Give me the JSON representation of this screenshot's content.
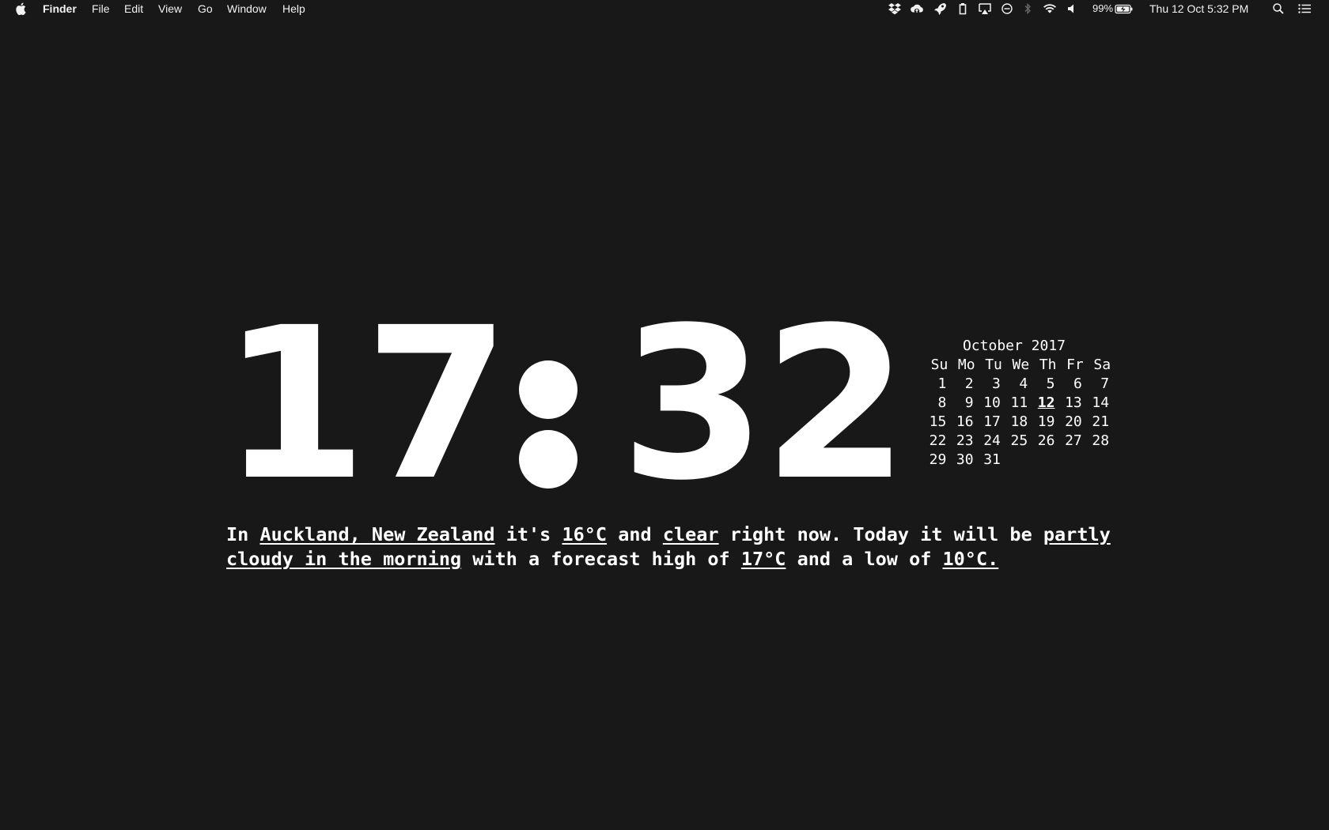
{
  "menubar": {
    "app_name": "Finder",
    "menus": [
      "File",
      "Edit",
      "View",
      "Go",
      "Window",
      "Help"
    ],
    "status_icons": [
      "dropbox-icon",
      "cloud-upload-icon",
      "rocket-icon",
      "clipboard-icon",
      "airplay-icon",
      "do-not-disturb-icon",
      "bluetooth-icon",
      "wifi-icon",
      "volume-icon",
      "battery-icon",
      "spotlight-icon",
      "notification-center-icon"
    ],
    "battery_percent": "99%",
    "datetime": "Thu 12 Oct  5:32 PM"
  },
  "clock": {
    "hours": "17",
    "minutes": "32"
  },
  "calendar": {
    "title": "October 2017",
    "weekdays": [
      "Su",
      "Mo",
      "Tu",
      "We",
      "Th",
      "Fr",
      "Sa"
    ],
    "weeks": [
      [
        "1",
        "2",
        "3",
        "4",
        "5",
        "6",
        "7"
      ],
      [
        "8",
        "9",
        "10",
        "11",
        "12",
        "13",
        "14"
      ],
      [
        "15",
        "16",
        "17",
        "18",
        "19",
        "20",
        "21"
      ],
      [
        "22",
        "23",
        "24",
        "25",
        "26",
        "27",
        "28"
      ],
      [
        "29",
        "30",
        "31",
        "",
        "",
        "",
        ""
      ]
    ],
    "today": "12"
  },
  "weather": {
    "t1": "In ",
    "location": "Auckland, New Zealand",
    "t2": " it's ",
    "current_temp": "16°C",
    "t3": " and ",
    "current_condition": "clear",
    "t4": " right now. Today it will be ",
    "forecast_condition": "partly cloudy in the morning",
    "t5": " with a forecast high of ",
    "high_temp": "17°C",
    "t6": " and a low of ",
    "low_temp": "10°C."
  }
}
